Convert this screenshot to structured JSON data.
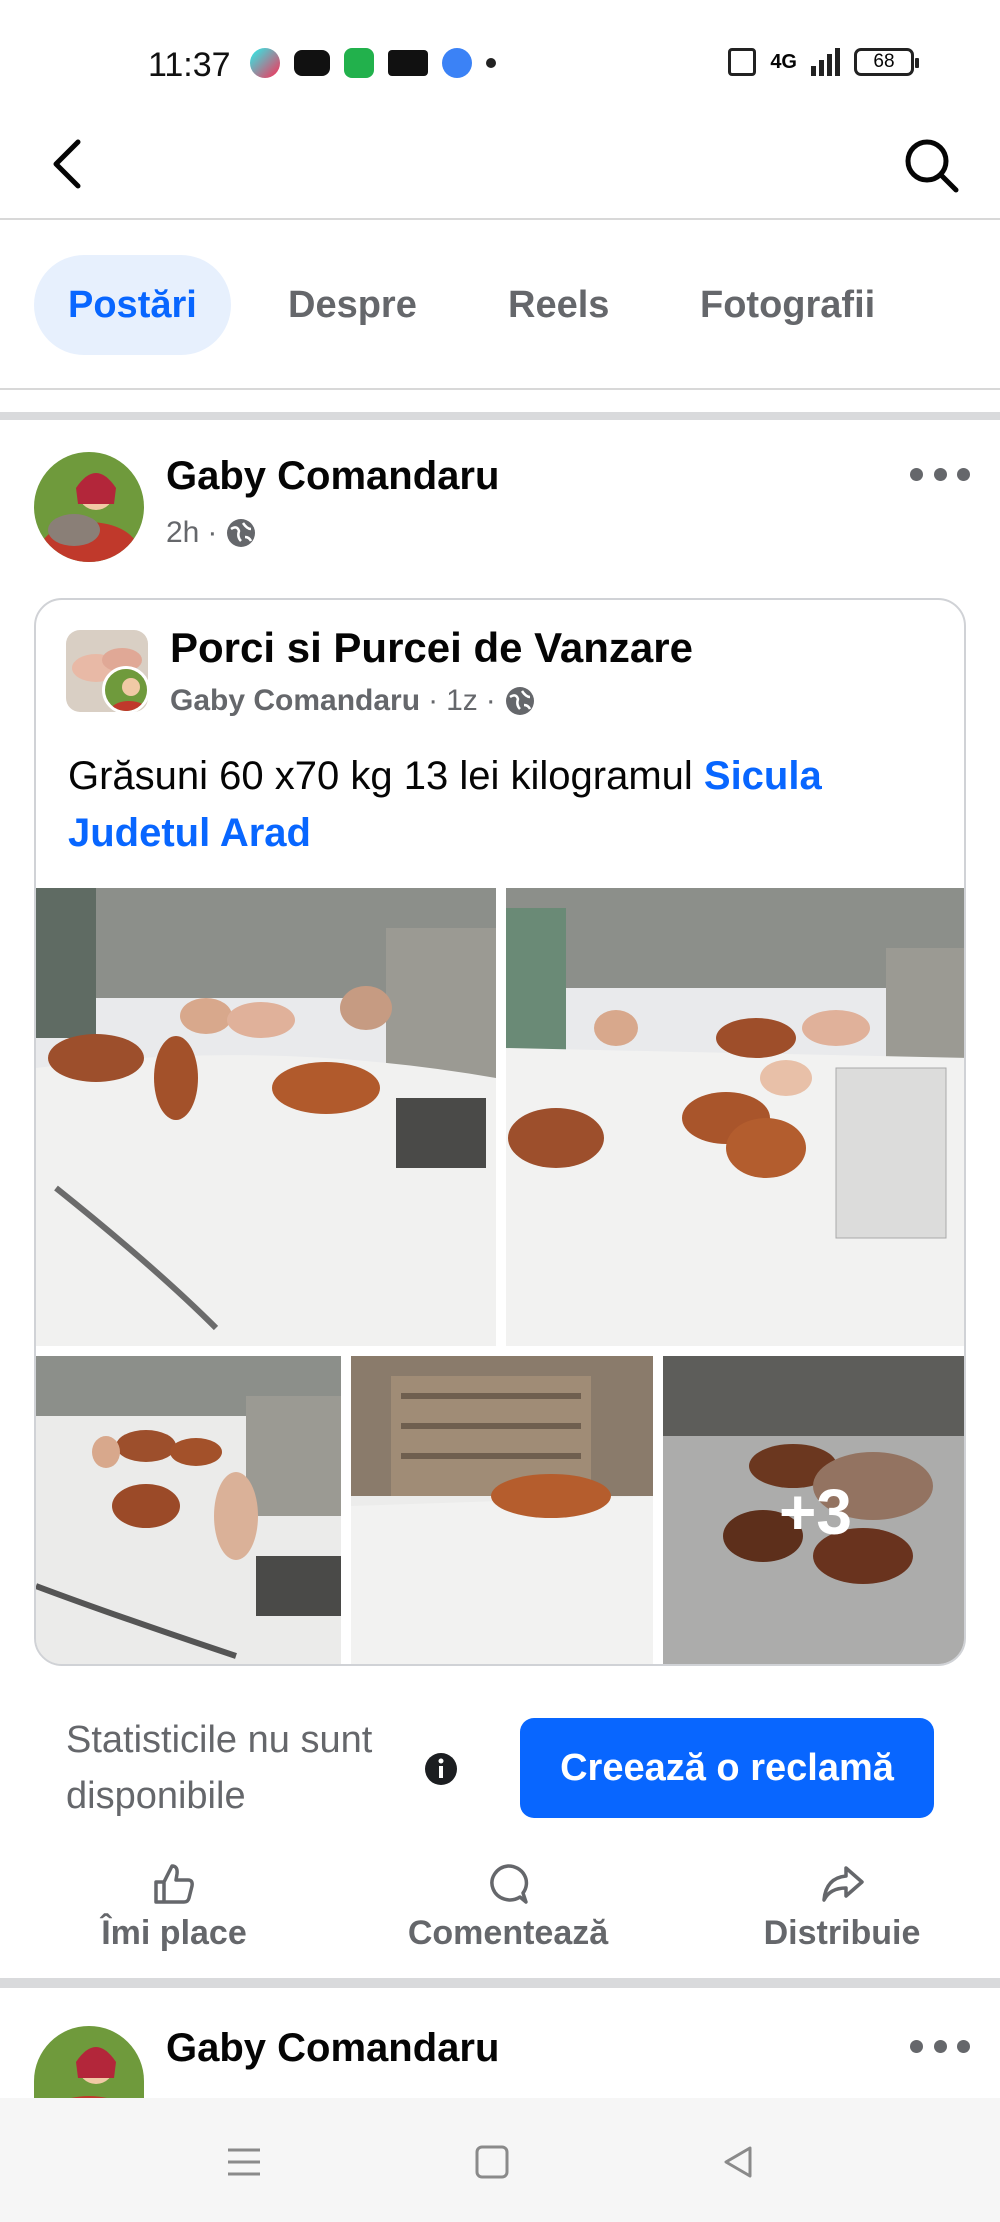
{
  "status_bar": {
    "time": "11:37",
    "battery": "68",
    "network": "4G"
  },
  "tabs": [
    {
      "label": "Postări"
    },
    {
      "label": "Despre"
    },
    {
      "label": "Reels"
    },
    {
      "label": "Fotografii"
    }
  ],
  "post": {
    "author": "Gaby Comandaru",
    "time": "2h",
    "separator": "·",
    "shared": {
      "group_name": "Porci si Purcei de Vanzare",
      "poster": "Gaby Comandaru",
      "time": "1z",
      "text": "Grăsuni 60 x70 kg 13 lei kilogramul ",
      "link_text": "Sicula Judetul Arad",
      "extra_photos": "+3"
    },
    "stats_text": "Statisticile nu sunt disponibile",
    "ad_button": "Creează o reclamă",
    "actions": {
      "like": "Îmi place",
      "comment": "Comentează",
      "share": "Distribuie"
    }
  },
  "next_post": {
    "author": "Gaby Comandaru"
  },
  "colors": {
    "accent": "#0866ff",
    "muted": "#65676b",
    "tab_active_bg": "#e7f0fd"
  }
}
